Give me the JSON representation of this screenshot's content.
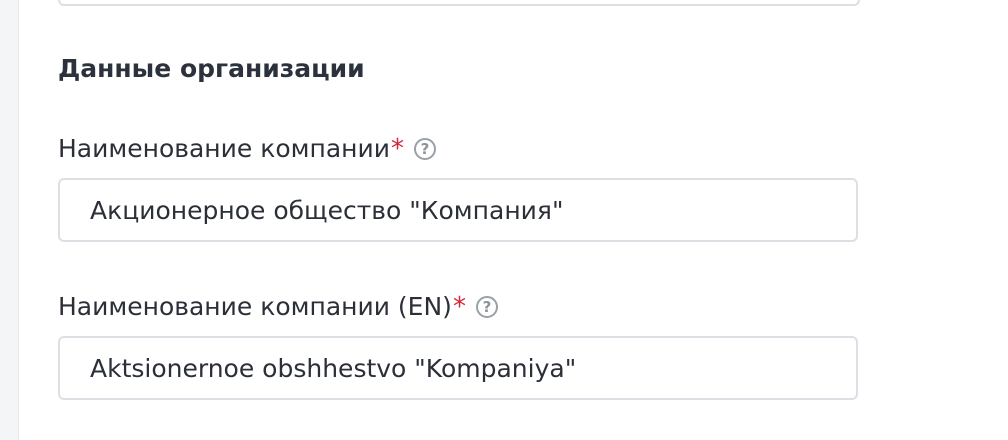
{
  "section": {
    "title": "Данные организации"
  },
  "fields": [
    {
      "label": "Наименование компании",
      "required_mark": "*",
      "help_icon": "?",
      "value": "Акционерное общество \"Компания\""
    },
    {
      "label": "Наименование компании (EN)",
      "required_mark": "*",
      "help_icon": "?",
      "value": "Aktsionernoe obshhestvo \"Kompaniya\""
    }
  ],
  "colors": {
    "required": "#d3263b",
    "border": "#dcdfe4",
    "text": "#2b2f38",
    "help_icon": "#9aa0a8"
  }
}
